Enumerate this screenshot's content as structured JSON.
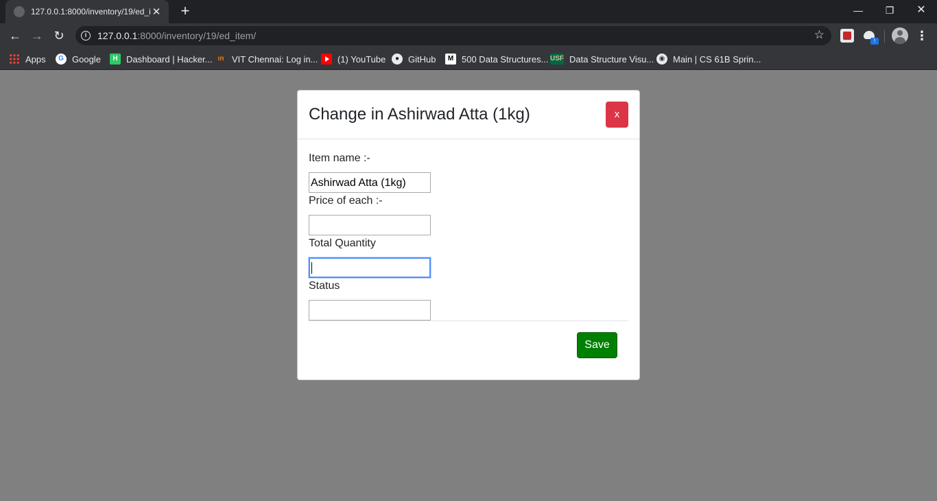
{
  "browser": {
    "tab_title": "127.0.0.1:8000/inventory/19/ed_i",
    "tab_close": "✕",
    "new_tab": "+",
    "url_host": "127.0.0.1",
    "url_path": ":8000/inventory/19/ed_item/",
    "window_controls": {
      "minimize": "—",
      "restore": "❐",
      "close": "✕"
    },
    "nav": {
      "back": "←",
      "forward": "→",
      "reload": "↻"
    },
    "info_icon": "i",
    "star_icon": "☆",
    "menu_icon": "⋮",
    "extension_badge": "!"
  },
  "bookmarks": [
    {
      "label": "Apps",
      "icon": "apps-icon",
      "glyph": ""
    },
    {
      "label": "Google",
      "icon": "google-icon",
      "glyph": "G"
    },
    {
      "label": "Dashboard | Hacker...",
      "icon": "hackerrank-icon",
      "glyph": "H"
    },
    {
      "label": "VIT Chennai: Log in...",
      "icon": "vit-icon",
      "glyph": "ın"
    },
    {
      "label": "(1) YouTube",
      "icon": "youtube-icon",
      "glyph": ""
    },
    {
      "label": "GitHub",
      "icon": "github-icon",
      "glyph": "●"
    },
    {
      "label": "500 Data Structures...",
      "icon": "medium-icon",
      "glyph": "M"
    },
    {
      "label": "Data Structure Visu...",
      "icon": "usf-icon",
      "glyph": "USF"
    },
    {
      "label": "Main | CS 61B Sprin...",
      "icon": "globe-icon",
      "glyph": "◉"
    }
  ],
  "modal": {
    "title": "Change in Ashirwad Atta (1kg)",
    "close_label": "x",
    "fields": [
      {
        "label": "Item name :-",
        "value": "Ashirwad Atta (1kg)"
      },
      {
        "label": "Price of each :-",
        "value": ""
      },
      {
        "label": "Total Quantity",
        "value": ""
      },
      {
        "label": "Status",
        "value": ""
      }
    ],
    "save_label": "Save"
  }
}
